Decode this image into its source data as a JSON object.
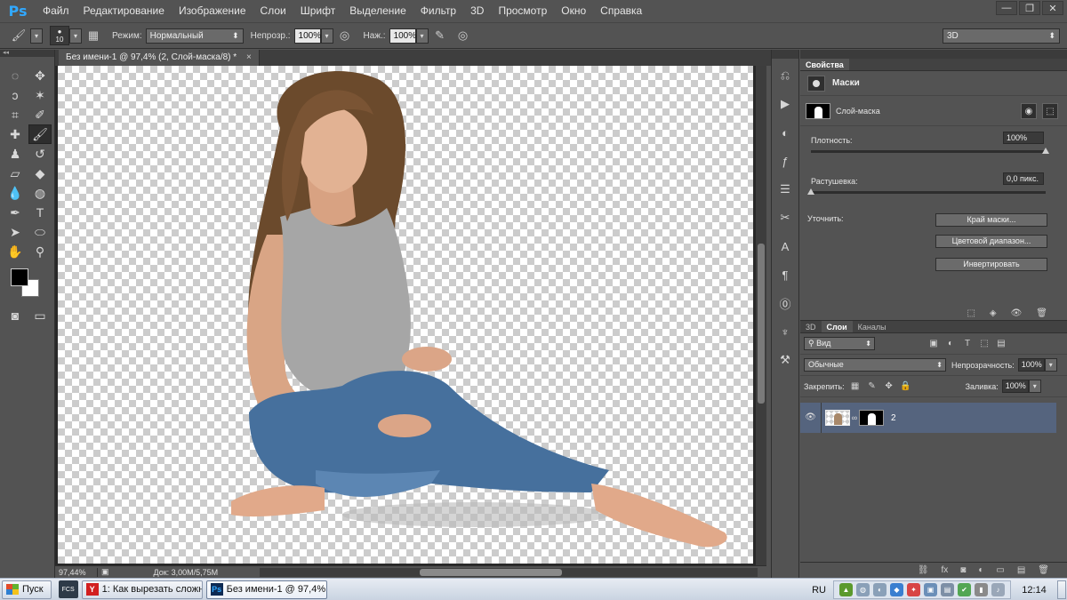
{
  "app": {
    "logo": "Ps"
  },
  "menu": [
    "Файл",
    "Редактирование",
    "Изображение",
    "Слои",
    "Шрифт",
    "Выделение",
    "Фильтр",
    "3D",
    "Просмотр",
    "Окно",
    "Справка"
  ],
  "window_controls": {
    "minimize": "—",
    "restore": "❐",
    "close": "✕"
  },
  "options": {
    "brush_size": "10",
    "mode_label": "Режим:",
    "mode_value": "Нормальный",
    "opacity_label": "Непрозр.:",
    "opacity_value": "100%",
    "flow_label": "Наж.:",
    "flow_value": "100%",
    "workspace": "3D"
  },
  "document": {
    "tab_title": "Без имени-1 @ 97,4% (2, Слой-маска/8) *",
    "tab_close": "×",
    "zoom": "97,44%",
    "doc_size": "Док: 3,00M/5,75M"
  },
  "properties": {
    "tabs": [
      "Свойства"
    ],
    "title": "Маски",
    "mask_type": "Слой-маска",
    "density_label": "Плотность:",
    "density_value": "100%",
    "density_level": 1.0,
    "feather_label": "Растушевка:",
    "feather_value": "0,0 пикс.",
    "feather_level": 0.0,
    "refine_label": "Уточнить:",
    "buttons": {
      "mask_edge": "Край маски...",
      "color_range": "Цветовой диапазон...",
      "invert": "Инвертировать"
    }
  },
  "layers": {
    "tabs": [
      "3D",
      "Слои",
      "Каналы"
    ],
    "filter_kind": "Вид",
    "blend_mode": "Обычные",
    "opacity_label": "Непрозрачность:",
    "opacity_value": "100%",
    "lock_label": "Закрепить:",
    "fill_label": "Заливка:",
    "fill_value": "100%",
    "items": [
      {
        "name": "2",
        "visible": true
      }
    ]
  },
  "taskbar": {
    "start": "Пуск",
    "quick_launch": "FCS",
    "tasks": [
      {
        "label": "1: Как вырезать сложн...",
        "icon": "Y",
        "icon_color": "#d21f1f"
      },
      {
        "label": "Без имени-1 @ 97,4%...",
        "icon": "Ps",
        "icon_color": "#0e2a53"
      }
    ],
    "lang": "RU",
    "clock": "12:14"
  }
}
